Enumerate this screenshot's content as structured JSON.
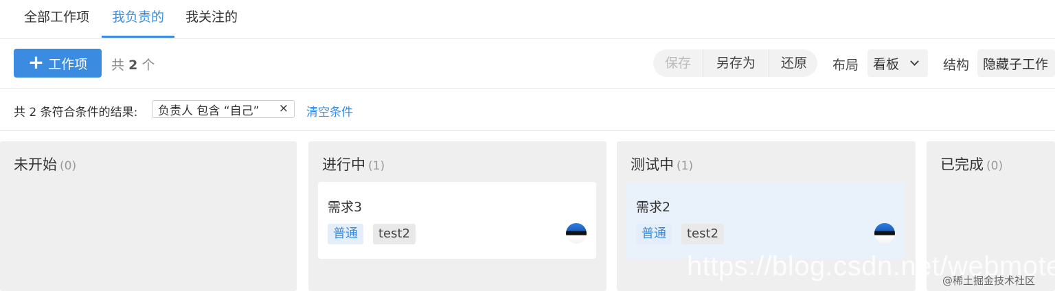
{
  "tabs": [
    {
      "label": "全部工作项",
      "active": false
    },
    {
      "label": "我负责的",
      "active": true
    },
    {
      "label": "我关注的",
      "active": false
    }
  ],
  "toolbar": {
    "add_label": "工作项",
    "count_prefix": "共",
    "count_value": "2",
    "count_suffix": "个",
    "save_label": "保存",
    "save_as_label": "另存为",
    "restore_label": "还原",
    "layout_label": "布局",
    "layout_value": "看板",
    "structure_label": "结构",
    "structure_value": "隐藏子工作"
  },
  "filter": {
    "result_text": "共 2 条符合条件的结果:",
    "chip_text": "负责人 包含 “自己”",
    "chip_close": "×",
    "clear_label": "清空条件"
  },
  "columns": [
    {
      "title": "未开始",
      "count": "(0)",
      "cards": []
    },
    {
      "title": "进行中",
      "count": "(1)",
      "cards": [
        {
          "title": "需求3",
          "level": "普通",
          "label": "test2",
          "highlighted": false
        }
      ]
    },
    {
      "title": "测试中",
      "count": "(1)",
      "cards": [
        {
          "title": "需求2",
          "level": "普通",
          "label": "test2",
          "highlighted": true
        }
      ]
    },
    {
      "title": "已完成",
      "count": "(0)",
      "cards": []
    }
  ],
  "watermark": {
    "url": "https://blog.csdn.net/webmote",
    "site": "@稀土掘金技术社区"
  },
  "colors": {
    "accent": "#3b8ce0",
    "column_bg": "#efefef",
    "card_highlight": "#e9f2fb"
  }
}
